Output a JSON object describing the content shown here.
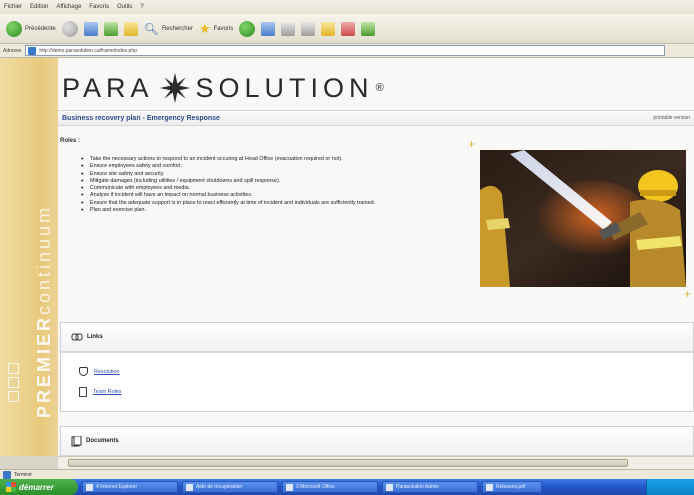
{
  "browser": {
    "menu": [
      "Fichier",
      "Edition",
      "Affichage",
      "Favoris",
      "Outils",
      "?"
    ],
    "toolbar": {
      "back_label": "Précédente",
      "search_label": "Rechercher",
      "favorites_label": "Favoris"
    },
    "address": {
      "label": "Adresse",
      "url": "http://demo.parasolution.ca/frame/index.php"
    },
    "status_text": "Terminé"
  },
  "page": {
    "logo": {
      "part1": "PARA",
      "part2": "SOLUTION",
      "reg": "®"
    },
    "side_band": {
      "brand_bold": "PREMIER",
      "brand_light": "continuum"
    },
    "title": "Business recovery plan - Emergency Response",
    "printable_label": "printable version",
    "roles_label": "Roles :",
    "duties": [
      "Take the necessary actions to respond to an incident occuring at Head Office (evacuation required or not).",
      "Ensure employees safety and comfort.",
      "Ensure site safety and security.",
      "Mitigate damages (including utilities / equipment shutdowns and spill response).",
      "Communicate with employees and media.",
      "Analyze if incident will have an impact on normal business activities.",
      "Ensure that the adequate support is in place to react efficiently at time of incident and individuals are sufficiently trained.",
      "Plan and exercise plan."
    ],
    "links_panel": {
      "title": "Links",
      "items": [
        "Resolution",
        "Team Roles"
      ]
    },
    "documents_panel": {
      "title": "Documents"
    }
  },
  "taskbar": {
    "start_label": "démarrer",
    "items": [
      "4 Internet Explorer",
      "Aide de récupération",
      "3 Microsoft Office",
      "Parasolution Admin",
      "Releases.pdf"
    ]
  }
}
